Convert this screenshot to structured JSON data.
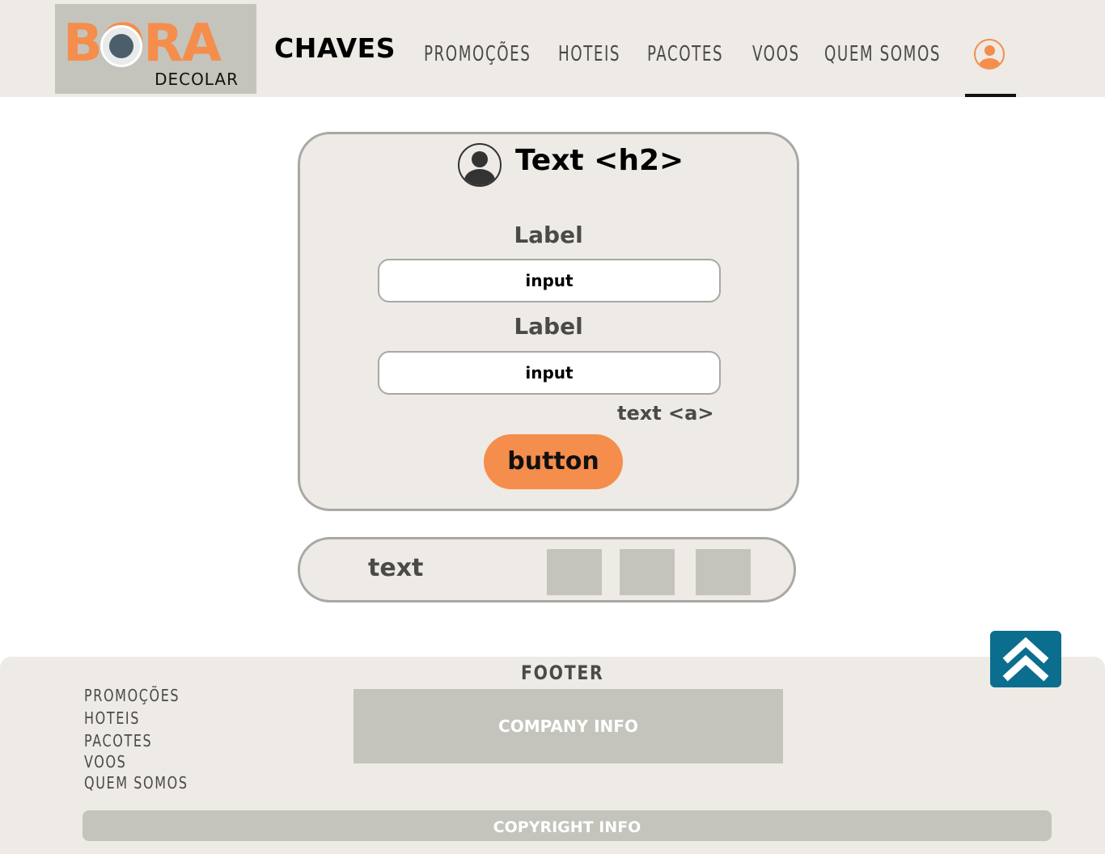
{
  "header": {
    "logo_text": "BORA",
    "logo_sub": "DECOLAR",
    "brand": "CHAVES",
    "nav": {
      "promocoes": "PROMOÇÕES",
      "hoteis": "HOTEIS",
      "pacotes": "PACOTES",
      "voos": "VOOS",
      "quem_somos": "QUEM SOMOS"
    },
    "user_icon": "user-circle-icon",
    "accent_color": "#f58d4c"
  },
  "card": {
    "title": "Text <h2>",
    "avatar_icon": "user-avatar-icon",
    "label1": "Label",
    "input1": "input",
    "label2": "Label",
    "input2": "input",
    "link": "text <a>",
    "button": "button",
    "button_color": "#f58d4c"
  },
  "social": {
    "text": "text"
  },
  "back_to_top": {
    "icon": "double-chevron-up-icon",
    "color": "#0c6e8f"
  },
  "footer": {
    "title": "FOOTER",
    "links": {
      "promocoes": "PROMOÇÕES",
      "hoteis": "HOTEIS",
      "pacotes": "PACOTES",
      "voos": "VOOS",
      "quem_somos": "QUEM SOMOS"
    },
    "company_info": "COMPANY INFO",
    "copyright_info": "COPYRIGHT INFO"
  }
}
